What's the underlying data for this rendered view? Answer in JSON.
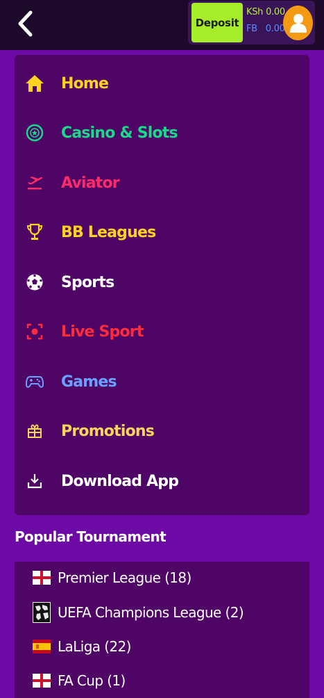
{
  "header": {
    "deposit_label": "Deposit",
    "ksh_label": "KSh",
    "ksh_value": "0.00",
    "fb_label": "FB",
    "fb_value": "0.00"
  },
  "menu": {
    "items": [
      {
        "label": "Home",
        "icon": "home-icon",
        "color": "#ffd21f"
      },
      {
        "label": "Casino & Slots",
        "icon": "casino-chip-icon",
        "color": "#19d98a"
      },
      {
        "label": "Aviator",
        "icon": "airplane-takeoff-icon",
        "color": "#ff2a6a"
      },
      {
        "label": "BB Leagues",
        "icon": "trophy-icon",
        "color": "#ffd21f"
      },
      {
        "label": "Sports",
        "icon": "soccer-ball-icon",
        "color": "#ffffff"
      },
      {
        "label": "Live Sport",
        "icon": "live-camera-icon",
        "color": "#ff2c3b"
      },
      {
        "label": "Games",
        "icon": "gamepad-icon",
        "color": "#6aa0ff"
      },
      {
        "label": "Promotions",
        "icon": "gift-icon",
        "color": "#ffd35c"
      },
      {
        "label": "Download App",
        "icon": "download-icon",
        "color": "#ffffff"
      }
    ]
  },
  "popular": {
    "title": "Popular Tournament",
    "items": [
      {
        "label": "Premier League (18)",
        "flag": "england-flag-icon"
      },
      {
        "label": "UEFA Champions League (2)",
        "flag": "world-map-icon"
      },
      {
        "label": "LaLiga (22)",
        "flag": "spain-flag-icon"
      },
      {
        "label": "FA Cup (1)",
        "flag": "england-flag-icon"
      }
    ]
  },
  "colors": {
    "background": "#6d0aa6",
    "panel": "#4f0565",
    "topbar": "#1d0a2a",
    "deposit": "#a6ec28",
    "avatar": "#f39a12"
  }
}
